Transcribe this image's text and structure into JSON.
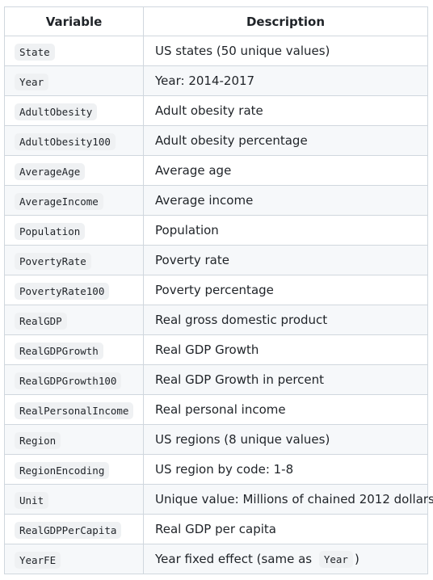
{
  "table": {
    "headers": {
      "variable": "Variable",
      "description": "Description"
    },
    "rows": [
      {
        "variable": "State",
        "description": "US states (50 unique values)"
      },
      {
        "variable": "Year",
        "description": "Year: 2014-2017"
      },
      {
        "variable": "AdultObesity",
        "description": "Adult obesity rate"
      },
      {
        "variable": "AdultObesity100",
        "description": "Adult obesity percentage"
      },
      {
        "variable": "AverageAge",
        "description": "Average age"
      },
      {
        "variable": "AverageIncome",
        "description": "Average income"
      },
      {
        "variable": "Population",
        "description": "Population"
      },
      {
        "variable": "PovertyRate",
        "description": "Poverty rate"
      },
      {
        "variable": "PovertyRate100",
        "description": "Poverty percentage"
      },
      {
        "variable": "RealGDP",
        "description": "Real gross domestic product"
      },
      {
        "variable": "RealGDPGrowth",
        "description": "Real GDP Growth"
      },
      {
        "variable": "RealGDPGrowth100",
        "description": "Real GDP Growth in percent"
      },
      {
        "variable": "RealPersonalIncome",
        "description": "Real personal income"
      },
      {
        "variable": "Region",
        "description": "US regions (8 unique values)"
      },
      {
        "variable": "RegionEncoding",
        "description": "US region by code: 1-8"
      },
      {
        "variable": "Unit",
        "description": "Unique value: Millions of chained 2012 dollars"
      },
      {
        "variable": "RealGDPPerCapita",
        "description": "Real GDP per capita"
      },
      {
        "variable": "YearFE",
        "description": "Year fixed effect (same as ",
        "description_code": "Year",
        "description_suffix": ")"
      }
    ]
  }
}
